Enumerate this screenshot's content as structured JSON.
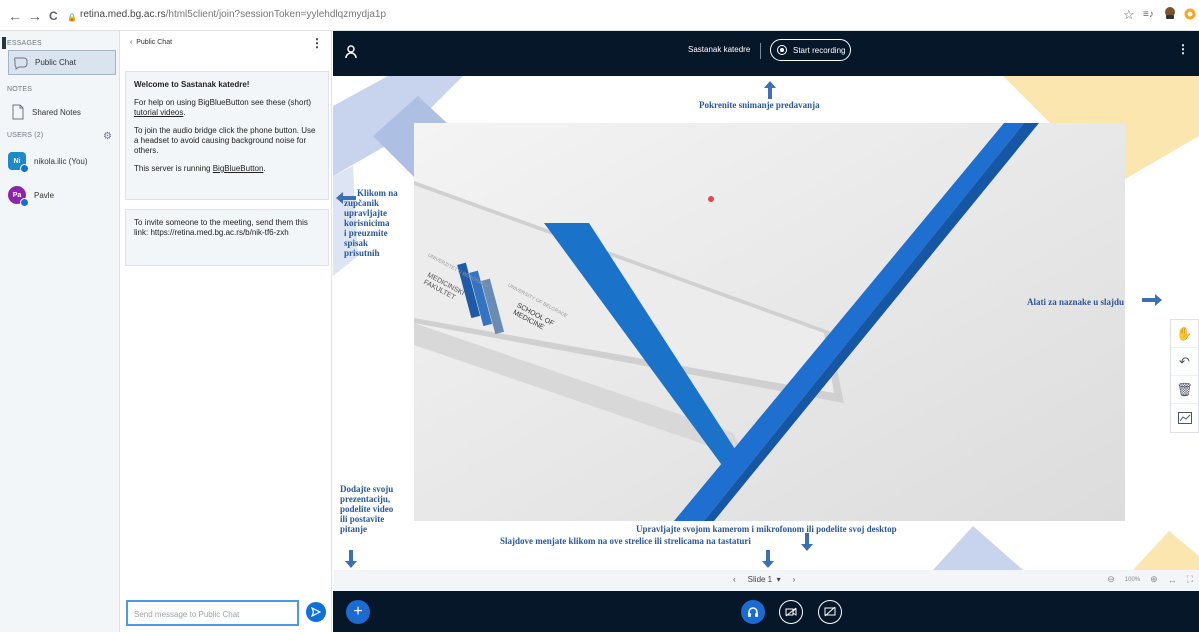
{
  "browser": {
    "back": "←",
    "forward": "→",
    "reload": "C",
    "lock": "🔒",
    "url_host": "retina.med.bg.ac.rs",
    "url_path": "/html5client/join?sessionToken=yylehdlqzmydja1p",
    "star": "☆",
    "media": "≡♪"
  },
  "userlist": {
    "messages_heading": "ESSAGES",
    "public_chat": "Public Chat",
    "notes_heading": "NOTES",
    "shared_notes": "Shared Notes",
    "users_heading": "USERS (2)",
    "users": [
      {
        "initials": "Ni",
        "name": "nikola.ilic (You)",
        "color": "#1e88c9"
      },
      {
        "initials": "Pa",
        "name": "Pavle",
        "color": "#8e24aa"
      }
    ]
  },
  "chat": {
    "header": "Public Chat",
    "welcome_prefix": "Welcome to ",
    "welcome_name": "Sastanak katedre!",
    "help_text_1": "For help on using BigBlueButton see these (short) ",
    "help_link": "tutorial videos",
    "help_text_2": ".",
    "audio_text": "To join the audio bridge click the phone button. Use a headset to avoid causing background noise for others.",
    "server_prefix": "This server is running ",
    "server_link": "BigBlueButton",
    "server_suffix": ".",
    "invite_text": "To invite someone to the meeting, send them this link: https://retina.med.bg.ac.rs/b/nik-tf6-zxh",
    "input_placeholder": "Send message to Public Chat"
  },
  "topbar": {
    "meeting_title": "Sastanak katedre",
    "start_recording": "Start recording"
  },
  "annotations": {
    "recording": "Pokrenite snimanje predavanja",
    "gear": [
      "Klikom na",
      "zupčanik",
      "upravljajte",
      "korisnicima",
      "i preuzmite",
      "spisak",
      "prisutnih"
    ],
    "tools": "Alati za naznake u slajdu",
    "camera": "Upravljajte svojom kamerom i mikrofonom ili podelite svoj desktop",
    "slides": "Slajdove menjate klikom na ove strelice ili strelicama na tastaturi",
    "presentation": [
      "Dodajte svoju",
      "prezentaciju,",
      "podelite video",
      "ili postavite",
      "pitanje"
    ]
  },
  "slide": {
    "logo_univ_left": "UNIVERZITET U BEOGRADU",
    "logo_med_fak": "MEDICINSKI FAKULTET",
    "logo_univ_right": "UNIVERSITY OF BELGRADE",
    "logo_school": "SCHOOL OF MEDICINE"
  },
  "bottombar": {
    "prev": "‹",
    "slide_label": "Slide 1",
    "caret": "▾",
    "next": "›",
    "zoom_out": "⊖",
    "zoom_level": "100%",
    "zoom_in": "⊕",
    "fit_width": "↔",
    "fullscreen": "⛶"
  },
  "colors": {
    "dark": "#06172a",
    "accent": "#0f70d7",
    "annotation": "#2b579a"
  }
}
